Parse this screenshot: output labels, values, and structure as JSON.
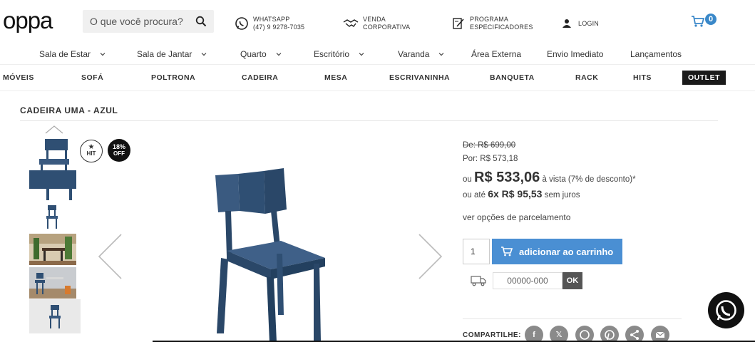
{
  "header": {
    "logo": "oppa",
    "search_placeholder": "O que você procura?",
    "whatsapp": {
      "line1": "WHATSAPP",
      "line2": "(47) 9 9278-7035"
    },
    "corporate": {
      "line1": "VENDA",
      "line2": "CORPORATIVA"
    },
    "specifiers": {
      "line1": "PROGRAMA",
      "line2": "ESPECIFICADORES"
    },
    "login": "LOGIN",
    "cart_count": "0"
  },
  "category_nav": [
    {
      "label": "Sala de Estar",
      "dropdown": true
    },
    {
      "label": "Sala de Jantar",
      "dropdown": true
    },
    {
      "label": "Quarto",
      "dropdown": true
    },
    {
      "label": "Escritório",
      "dropdown": true
    },
    {
      "label": "Varanda",
      "dropdown": true
    },
    {
      "label": "Área Externa",
      "dropdown": false
    },
    {
      "label": "Envio Imediato",
      "dropdown": false
    },
    {
      "label": "Lançamentos",
      "dropdown": false
    }
  ],
  "product_nav": [
    "MÓVEIS",
    "SOFÁ",
    "POLTRONA",
    "CADEIRA",
    "MESA",
    "ESCRIVANINHA",
    "BANQUETA",
    "RACK",
    "HITS",
    "OUTLET"
  ],
  "product": {
    "title": "CADEIRA UMA - AZUL",
    "badge_hit": "HIT",
    "badge_off_pct": "18%",
    "badge_off_word": "OFF",
    "color": "#2f4f73"
  },
  "pricing": {
    "from": "De: R$ 699,00",
    "by": "Por: R$ 573,18",
    "cash_prefix": "ou",
    "cash_price": "R$ 533,06",
    "cash_suffix": "à vista (7% de desconto)*",
    "installments_prefix": "ou até",
    "installments_value": "6x R$ 95,53",
    "installments_suffix": "sem juros",
    "options_link": "ver opções de parcelamento"
  },
  "purchase": {
    "quantity": "1",
    "add_to_cart": "adicionar ao carrinho",
    "cep_placeholder": "00000-000",
    "ok": "OK",
    "button_color": "#4a8fd3"
  },
  "share": {
    "label": "COMPARTILHE:",
    "icons": [
      "facebook-icon",
      "x-icon",
      "whatsapp-icon",
      "pinterest-icon",
      "share-icon",
      "email-icon"
    ]
  }
}
